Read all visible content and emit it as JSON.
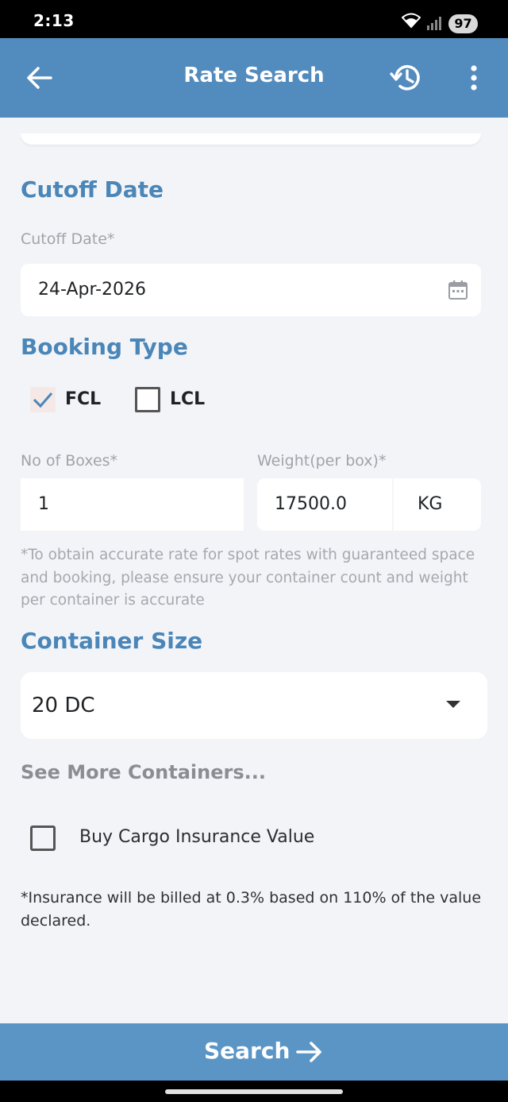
{
  "status_bar": {
    "time": "2:13",
    "battery": "97"
  },
  "app_bar": {
    "title": "Rate Search"
  },
  "cutoff": {
    "section_title": "Cutoff Date",
    "field_label": "Cutoff Date*",
    "value": "24-Apr-2026"
  },
  "booking_type": {
    "section_title": "Booking Type",
    "options": [
      {
        "label": "FCL",
        "checked": true
      },
      {
        "label": "LCL",
        "checked": false
      }
    ]
  },
  "boxes": {
    "label": "No of Boxes*",
    "value": "1"
  },
  "weight": {
    "label": "Weight(per box)*",
    "value": "17500.0",
    "unit": "KG"
  },
  "accuracy_note": "*To obtain accurate rate for spot rates with guaranteed space and booking, please ensure your container count and weight per container is accurate",
  "container_size": {
    "section_title": "Container Size",
    "selected": "20 DC",
    "see_more": "See More Containers..."
  },
  "insurance": {
    "label": "Buy Cargo Insurance Value",
    "checked": false,
    "note": "*Insurance will be billed at 0.3% based on 110% of the value declared."
  },
  "search_button": {
    "label": "Search"
  },
  "colors": {
    "accent": "#528bbd",
    "section_title": "#4a86b8",
    "search_bar": "#5b95c6"
  }
}
